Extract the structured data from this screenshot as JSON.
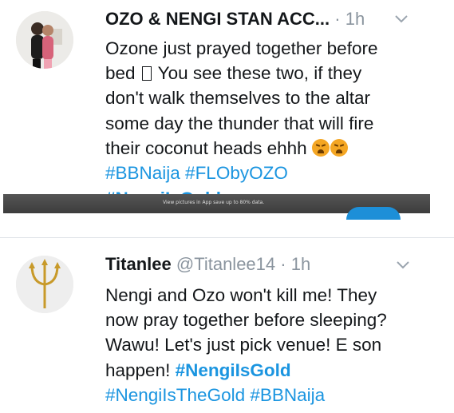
{
  "tweets": [
    {
      "author_name": "OZO & NENGI STAN ACC...",
      "separator": "·",
      "time": "1h",
      "body_lines": [
        "Ozone just prayed together before",
        "bed",
        "You see these two, if they",
        "don't walk themselves to the altar",
        "some day the thunder that will fire",
        "their coconut heads ehhh"
      ],
      "hashtags_line": "#BBNaija #FLObyOZO",
      "hashtag_bold": "#NengiIsGold"
    },
    {
      "author_name": "Titanlee",
      "handle": "@Titanlee14",
      "separator": "·",
      "time": "1h",
      "body_lines": [
        "Nengi and Ozo won't kill me! They",
        "now pray together before sleeping?",
        "Wawu! Let's just pick venue! E son",
        "happen!"
      ],
      "inline_hashtag": "#NengiIsGold",
      "hashtags_line": "#NengiIsTheGold #BBNaija"
    }
  ],
  "overlay": {
    "text": "View pictures in App save up to 80% data."
  },
  "icons": {
    "caret": "chevron-down-icon",
    "emoji": "weary-face-emoji",
    "avatar1": "couple-photo-avatar",
    "avatar2": "trident-avatar"
  },
  "colors": {
    "link": "#1b95e0",
    "muted": "#8a949e",
    "text": "#14171a"
  }
}
